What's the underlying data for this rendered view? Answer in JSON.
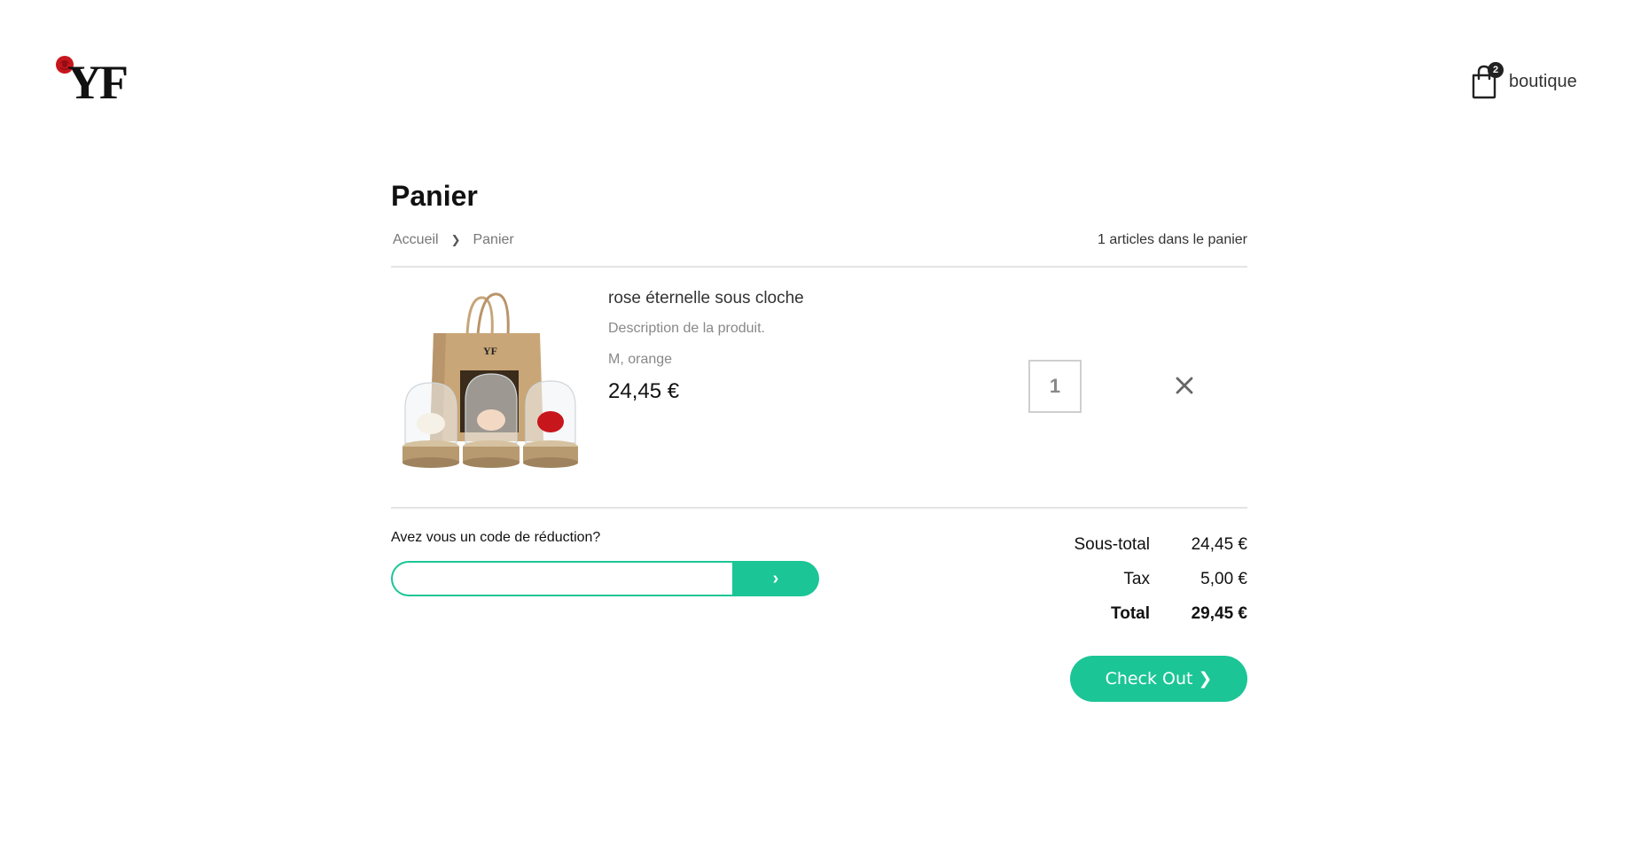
{
  "header": {
    "logo_text": "YF",
    "cart_badge": "2",
    "cart_label": "boutique"
  },
  "page": {
    "title": "Panier",
    "breadcrumb": [
      "Accueil",
      "Panier"
    ],
    "breadcrumb_separator": "❯",
    "items_count": "1 articles dans le panier"
  },
  "cart_item": {
    "name": "rose éternelle sous cloche",
    "description": "Description de la produit.",
    "variant": "M, orange",
    "price": "24,45 €",
    "quantity": "1"
  },
  "promo": {
    "label": "Avez vous un code de réduction?",
    "input_value": "",
    "submit_icon": "›"
  },
  "totals": {
    "subtotal_label": "Sous-total",
    "subtotal_value": "24,45 €",
    "tax_label": "Tax",
    "tax_value": "5,00 €",
    "total_label": "Total",
    "total_value": "29,45 €"
  },
  "checkout": {
    "label": "Check Out",
    "chevron": "❯"
  },
  "colors": {
    "accent": "#1bc596",
    "rose": "#c8161d"
  }
}
